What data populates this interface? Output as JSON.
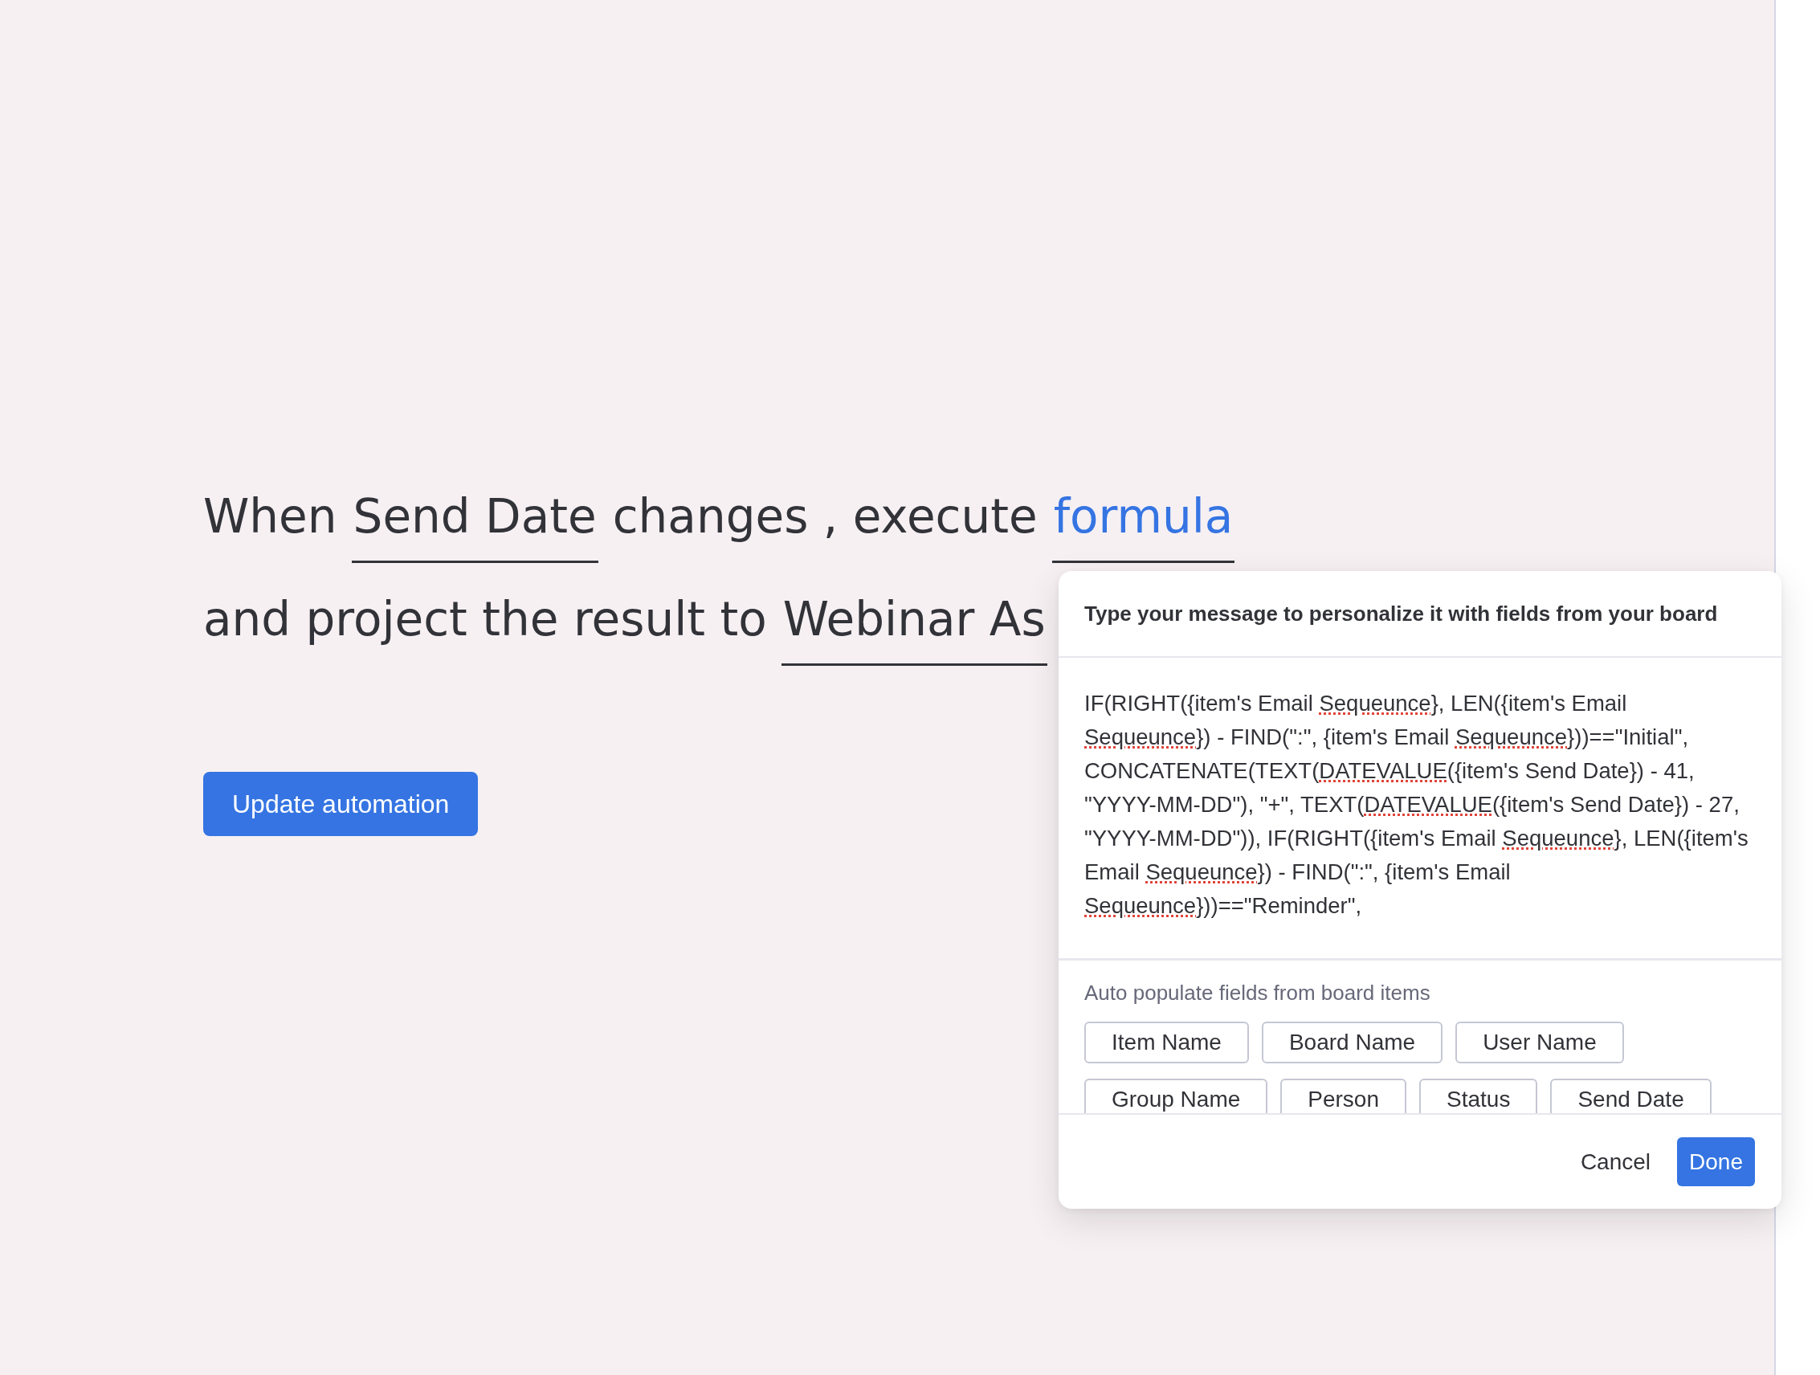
{
  "sentence": {
    "lines": [
      [
        {
          "kind": "text",
          "text": "When"
        },
        {
          "kind": "field",
          "text": "Send Date"
        },
        {
          "kind": "text",
          "text": "changes , execute"
        },
        {
          "kind": "link",
          "text": "formula"
        }
      ],
      [
        {
          "kind": "text",
          "text": "and project the result to"
        },
        {
          "kind": "field",
          "text": "Webinar As"
        }
      ]
    ]
  },
  "update_button": "Update automation",
  "popup": {
    "title": "Type your message to personalize it with fields from your board",
    "message_lines": [
      [
        {
          "text": "IF(RIGHT({item's Email ",
          "misspelled": false
        },
        {
          "text": "Sequeunce",
          "misspelled": true
        },
        {
          "text": "}, LEN({item's Email",
          "misspelled": false
        }
      ],
      [
        {
          "text": "Sequeunce",
          "misspelled": true
        },
        {
          "text": "}) - FIND(\":\", {item's Email ",
          "misspelled": false
        },
        {
          "text": "Sequeunce",
          "misspelled": true
        },
        {
          "text": "}))==\"Initial\",",
          "misspelled": false
        }
      ],
      [
        {
          "text": "CONCATENATE(TEXT(",
          "misspelled": false
        },
        {
          "text": "DATEVALUE",
          "misspelled": true
        },
        {
          "text": "({item's Send Date}) - 41,",
          "misspelled": false
        }
      ],
      [
        {
          "text": "\"YYYY-MM-DD\"), \"+\", TEXT(",
          "misspelled": false
        },
        {
          "text": "DATEVALUE",
          "misspelled": true
        },
        {
          "text": "({item's Send Date}) - 27,",
          "misspelled": false
        }
      ],
      [
        {
          "text": "\"YYYY-MM-DD\")), IF(RIGHT({item's Email ",
          "misspelled": false
        },
        {
          "text": "Sequeunce",
          "misspelled": true
        },
        {
          "text": "}, LEN({item's",
          "misspelled": false
        }
      ],
      [
        {
          "text": "Email ",
          "misspelled": false
        },
        {
          "text": "Sequeunce",
          "misspelled": true
        },
        {
          "text": "}) - FIND(\":\", {item's Email",
          "misspelled": false
        }
      ],
      [
        {
          "text": "Sequeunce",
          "misspelled": true
        },
        {
          "text": "}))==\"Reminder\",",
          "misspelled": false
        }
      ]
    ],
    "auto_populate": {
      "label": "Auto populate fields from board items",
      "fields": [
        "Item Name",
        "Board Name",
        "User Name",
        "Group Name",
        "Person",
        "Status",
        "Send Date"
      ]
    },
    "buttons": [
      {
        "kind": "secondary",
        "label": "Cancel"
      },
      {
        "kind": "primary",
        "label": "Done"
      }
    ]
  }
}
